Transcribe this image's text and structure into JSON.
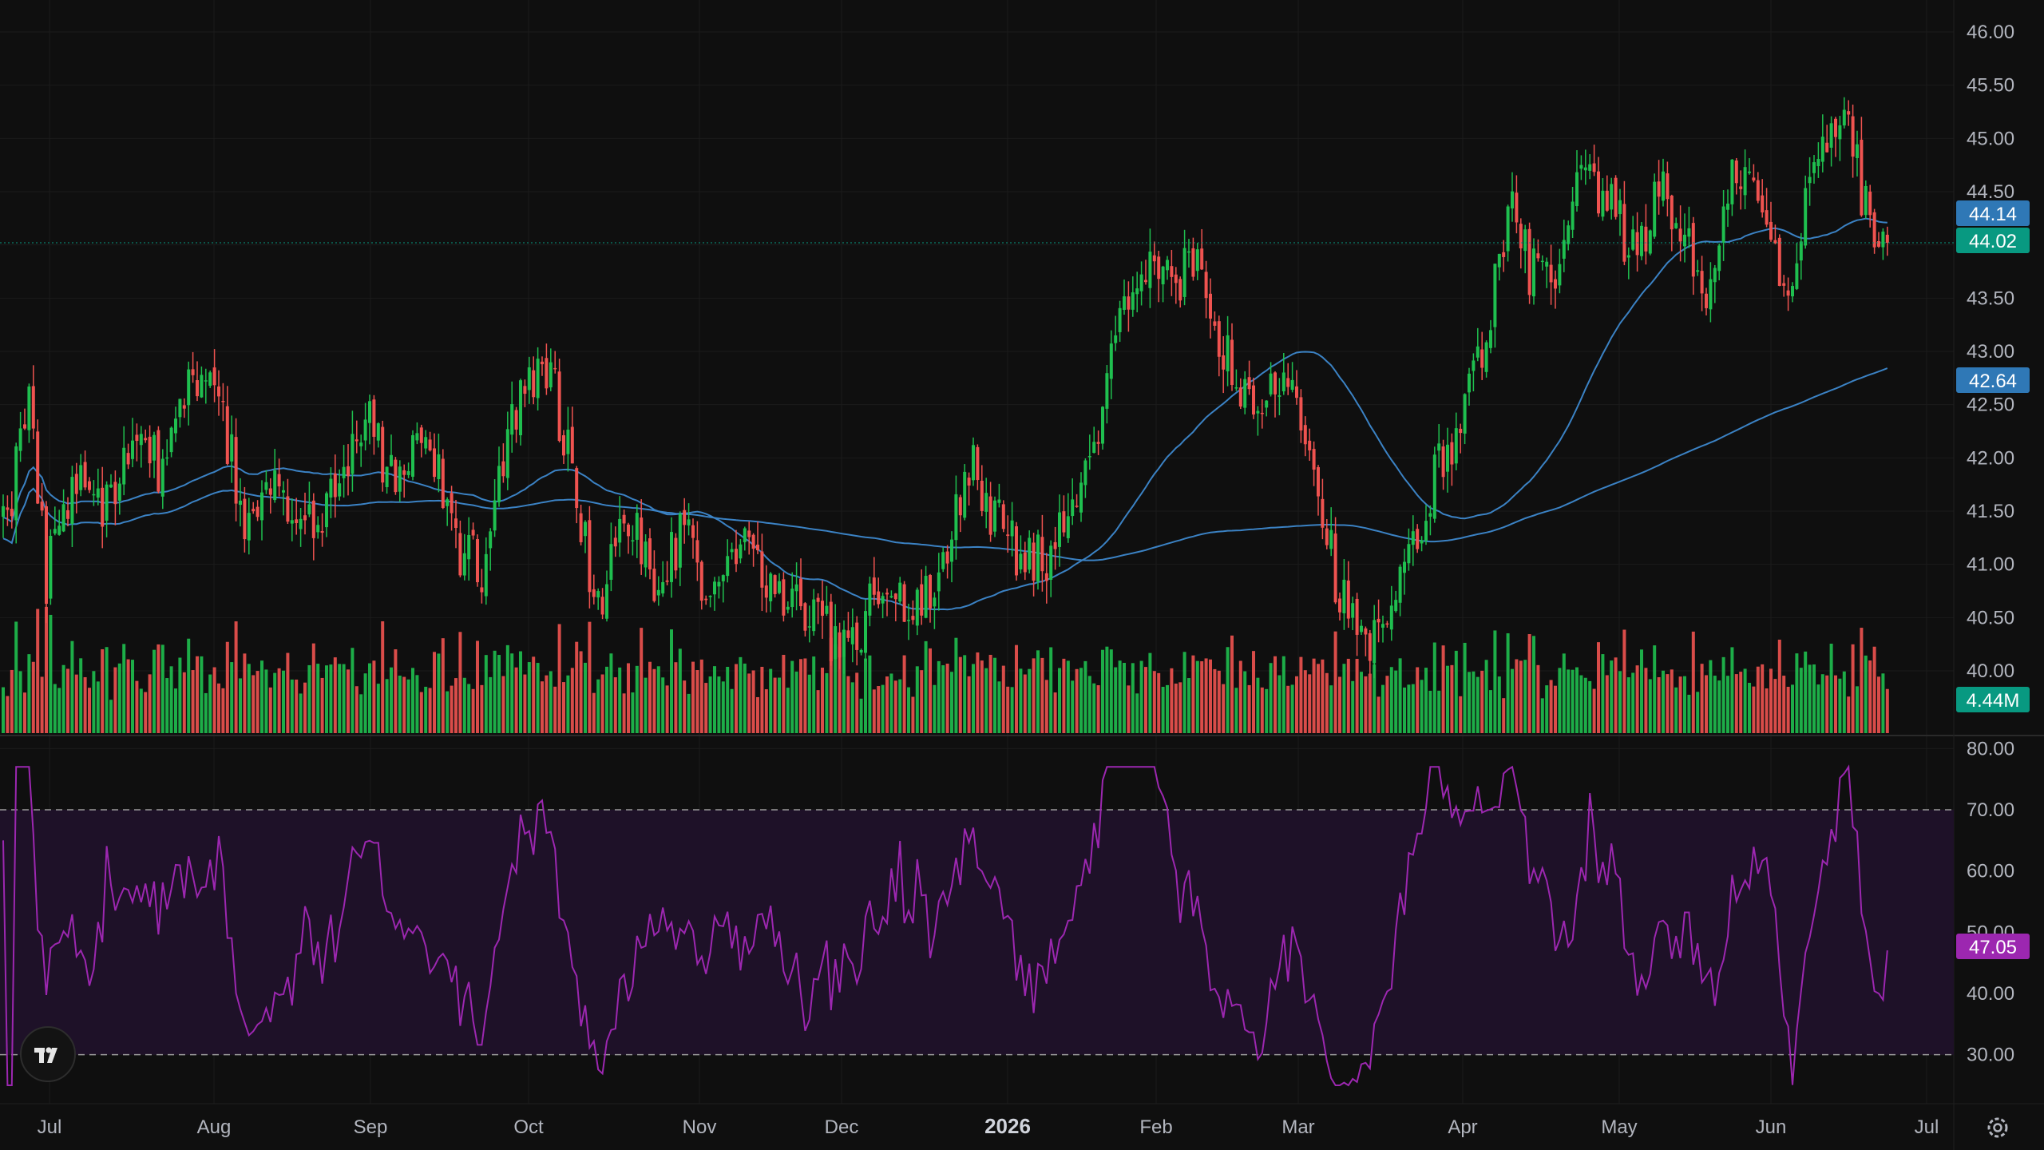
{
  "chart_data": {
    "type": "candlestick",
    "time_axis": {
      "labels": [
        "Jul",
        "Aug",
        "Sep",
        "Oct",
        "Nov",
        "Dec",
        "2026",
        "Feb",
        "Mar",
        "Apr",
        "May",
        "Jun",
        "Jul"
      ],
      "bold_label": "2026"
    },
    "price_panel": {
      "ylim": [
        39.4,
        46.3
      ],
      "ticks": [
        "40.00",
        "40.50",
        "41.00",
        "41.50",
        "42.00",
        "42.50",
        "43.00",
        "43.50",
        "44.00",
        "44.50",
        "45.00",
        "45.50",
        "46.00"
      ],
      "last_price": "44.02",
      "last_price_value": 44.02,
      "ma_fast": {
        "label": "44.14",
        "last_value": 44.14
      },
      "ma_slow": {
        "label": "42.64",
        "last_value": 42.64
      },
      "volume_label": "4.44M",
      "anchors": [
        [
          0,
          41.3
        ],
        [
          6,
          42.4
        ],
        [
          10,
          40.9
        ],
        [
          16,
          41.8
        ],
        [
          24,
          41.6
        ],
        [
          30,
          42.1
        ],
        [
          38,
          41.9
        ],
        [
          44,
          42.7
        ],
        [
          50,
          42.5
        ],
        [
          56,
          41.4
        ],
        [
          62,
          41.9
        ],
        [
          72,
          41.3
        ],
        [
          84,
          42.4
        ],
        [
          90,
          41.8
        ],
        [
          98,
          42.3
        ],
        [
          106,
          41.1
        ],
        [
          112,
          40.95
        ],
        [
          118,
          42.4
        ],
        [
          124,
          42.9
        ],
        [
          128,
          42.6
        ],
        [
          132,
          41.8
        ],
        [
          138,
          40.6
        ],
        [
          146,
          41.5
        ],
        [
          150,
          40.8
        ],
        [
          158,
          41.3
        ],
        [
          164,
          40.7
        ],
        [
          170,
          41.2
        ],
        [
          178,
          40.8
        ],
        [
          186,
          40.6
        ],
        [
          196,
          40.2
        ],
        [
          204,
          40.8
        ],
        [
          212,
          40.5
        ],
        [
          220,
          41.3
        ],
        [
          224,
          42.0
        ],
        [
          230,
          41.4
        ],
        [
          236,
          41.1
        ],
        [
          242,
          41.0
        ],
        [
          250,
          41.7
        ],
        [
          256,
          42.6
        ],
        [
          262,
          43.8
        ],
        [
          268,
          43.6
        ],
        [
          276,
          43.8
        ],
        [
          284,
          42.9
        ],
        [
          290,
          42.3
        ],
        [
          298,
          42.9
        ],
        [
          304,
          42.0
        ],
        [
          310,
          40.7
        ],
        [
          316,
          40.2
        ],
        [
          320,
          40.3
        ],
        [
          326,
          41.0
        ],
        [
          332,
          41.8
        ],
        [
          340,
          42.6
        ],
        [
          346,
          43.6
        ],
        [
          350,
          44.3
        ],
        [
          354,
          43.8
        ],
        [
          360,
          43.6
        ],
        [
          366,
          44.6
        ],
        [
          372,
          44.4
        ],
        [
          378,
          43.9
        ],
        [
          384,
          44.5
        ],
        [
          390,
          44.1
        ],
        [
          396,
          43.5
        ],
        [
          402,
          44.8
        ],
        [
          408,
          44.3
        ],
        [
          414,
          43.4
        ],
        [
          420,
          44.9
        ],
        [
          426,
          45.3
        ],
        [
          430,
          44.7
        ],
        [
          434,
          44.1
        ],
        [
          437,
          43.9
        ]
      ]
    },
    "rsi_panel": {
      "ylim": [
        22,
        82
      ],
      "ticks": [
        "30.00",
        "40.00",
        "50.00",
        "60.00",
        "70.00",
        "80.00"
      ],
      "overbought": 70,
      "oversold": 30,
      "current_label": "47.05",
      "current_value": 47.05
    },
    "colors": {
      "background": "#0f0f0f",
      "up": "#26a69a",
      "up_volume": "#1fbf4f",
      "down": "#ef5350",
      "ma": "#3b82c4",
      "rsi": "#9c27b0",
      "rsi_band": "#1e1128",
      "last_price_tag": "#089981",
      "ma_tag": "#2f78b6",
      "rsi_tag": "#9c27b0",
      "axis_text": "#b2b5be"
    }
  },
  "icons": {
    "logo": "tradingview-logo-icon",
    "settings": "gear-icon"
  }
}
